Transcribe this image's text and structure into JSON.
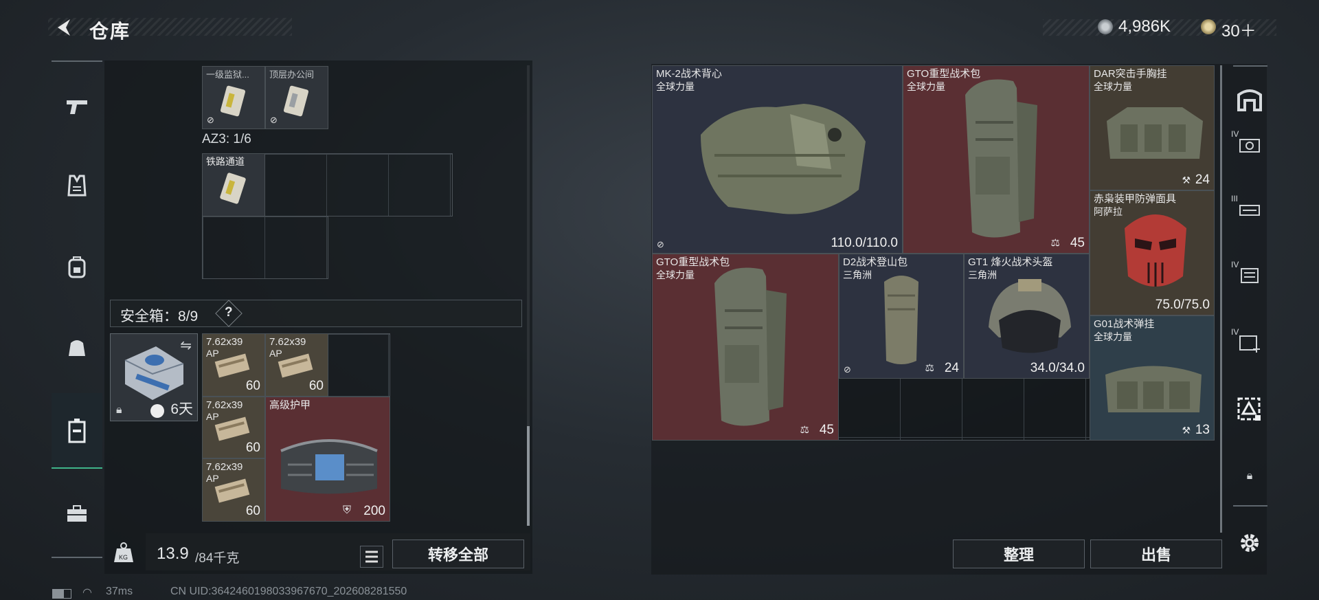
{
  "header": {
    "title": "仓库",
    "currency_value": "4,986K",
    "token_value": "30＋"
  },
  "sidebar": {
    "items": [
      {
        "name": "weapon"
      },
      {
        "name": "armor"
      },
      {
        "name": "backpack"
      },
      {
        "name": "bag"
      },
      {
        "name": "safebox",
        "active": true
      },
      {
        "name": "case"
      }
    ]
  },
  "left": {
    "top_items": [
      {
        "label": "一级监狱..."
      },
      {
        "label": "顶层办公间"
      }
    ],
    "az3_label": "AZ3: 1/6",
    "rail_item": {
      "label": "铁路通道"
    },
    "safe_label": "安全箱：8/9",
    "safe_help": "?",
    "safebox_timer": "6天",
    "ammo": [
      {
        "label": "7.62x39",
        "sub": "AP",
        "count": "60"
      },
      {
        "label": "7.62x39",
        "sub": "AP",
        "count": "60"
      },
      {
        "label": "7.62x39",
        "sub": "AP",
        "count": "60"
      },
      {
        "label": "7.62x39",
        "sub": "AP",
        "count": "60"
      }
    ],
    "armor_item": {
      "label": "高级护甲",
      "count": "200"
    },
    "weight_value": "13.9",
    "weight_max": "/84千克",
    "transfer_all": "转移全部"
  },
  "right": {
    "items": [
      {
        "label": "MK-2战术背心",
        "sub": "全球力量",
        "value": "110.0/110.0"
      },
      {
        "label": "GTO重型战术包",
        "sub": "全球力量",
        "value": "45"
      },
      {
        "label": "DAR突击手胸挂",
        "sub": "全球力量",
        "value": "24"
      },
      {
        "label": "赤枭装甲防弹面具",
        "sub": "阿萨拉",
        "value": "75.0/75.0"
      },
      {
        "label": "GTO重型战术包",
        "sub": "全球力量",
        "value": "45"
      },
      {
        "label": "D2战术登山包",
        "sub": "三角洲",
        "value": "24"
      },
      {
        "label": "GT1 烽火战术头盔",
        "sub": "三角洲",
        "value": "34.0/34.0"
      },
      {
        "label": "G01战术弹挂",
        "sub": "全球力量",
        "value": "13"
      }
    ],
    "tabs": [
      {
        "roman": ""
      },
      {
        "roman": "IV"
      },
      {
        "roman": "III"
      },
      {
        "roman": "IV"
      },
      {
        "roman": "IV"
      },
      {
        "roman": ""
      }
    ],
    "sort_label": "整理",
    "sell_label": "出售"
  },
  "status": {
    "ping": "37ms",
    "uid": "CN UID:3642460198033967670_202608281550"
  },
  "colors": {
    "accent": "#3fb58a",
    "red_item": "#5a2f33",
    "tan_item": "#4a453a",
    "navy_item": "#2d3240",
    "teal_item": "#2f3f4a"
  }
}
